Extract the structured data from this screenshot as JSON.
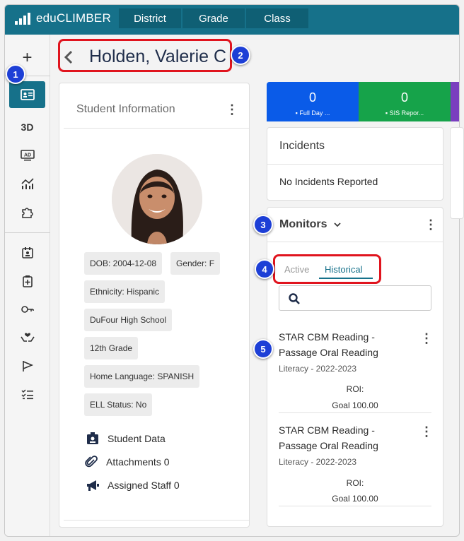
{
  "brand": "eduCLIMBER",
  "nav_tabs": [
    "District",
    "Grade",
    "Class"
  ],
  "sidebar": {
    "plus": "+",
    "threed": "3D"
  },
  "header": {
    "title": "Holden, Valerie C"
  },
  "student_panel": {
    "title": "Student Information",
    "chips": [
      "DOB: 2004-12-08",
      "Gender: F",
      "Ethnicity: Hispanic",
      "DuFour High School",
      "12th Grade",
      "Home Language: SPANISH",
      "ELL Status: No"
    ],
    "links": [
      "Student Data",
      "Attachments 0",
      "Assigned Staff 0"
    ]
  },
  "stats": [
    {
      "value": "0",
      "label": "Full Day ...",
      "color": "#0a5be8"
    },
    {
      "value": "0",
      "label": "SIS Repor...",
      "color": "#16a34a"
    }
  ],
  "incidents": {
    "title": "Incidents",
    "empty_text": "No Incidents Reported"
  },
  "monitors": {
    "title": "Monitors",
    "tabs": [
      "Active",
      "Historical"
    ],
    "active_tab": "Historical",
    "items": [
      {
        "title_line1": "STAR CBM Reading -",
        "title_line2": "Passage Oral Reading",
        "subtitle": "Literacy - 2022-2023",
        "roi": "ROI:",
        "goal": "Goal 100.00"
      },
      {
        "title_line1": "STAR CBM Reading -",
        "title_line2": "Passage Oral Reading",
        "subtitle": "Literacy - 2022-2023",
        "roi": "ROI:",
        "goal": "Goal 100.00"
      }
    ]
  },
  "annotations": [
    "1",
    "2",
    "3",
    "4",
    "5"
  ],
  "colors": {
    "primary": "#16718a",
    "callout": "#e0141e",
    "badge": "#1d3fd6"
  }
}
